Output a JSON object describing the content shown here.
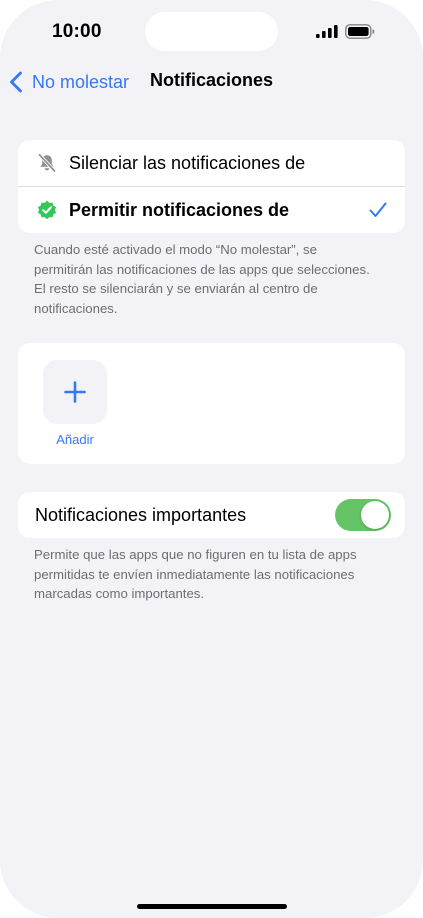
{
  "status_bar": {
    "time": "10:00",
    "signal_icon": "cellular-signal-icon",
    "battery_icon": "battery-icon"
  },
  "nav": {
    "back_label": "No molestar",
    "title": "Notificaciones"
  },
  "mode_group": {
    "options": [
      {
        "label": "Silenciar las notificaciones de",
        "icon": "bell-slash-icon",
        "selected": false
      },
      {
        "label": "Permitir notificaciones de",
        "icon": "verified-badge-icon",
        "selected": true
      }
    ],
    "footnote": "Cuando esté activado el modo “No molestar”, se permitirán las notificaciones de las apps que selecciones. El resto se silenciarán y se enviarán al centro de notificaciones."
  },
  "apps_group": {
    "add_label": "Añadir"
  },
  "important_group": {
    "label": "Notificaciones importantes",
    "toggle_on": true,
    "footnote": "Permite que las apps que no figuren en tu lista de apps permitidas te envíen inmediatamente las notificaciones marcadas como importantes."
  },
  "colors": {
    "accent": "#3478f6",
    "toggle_on": "#65c466",
    "check_badge": "#34c759",
    "background": "#f2f2f7"
  }
}
